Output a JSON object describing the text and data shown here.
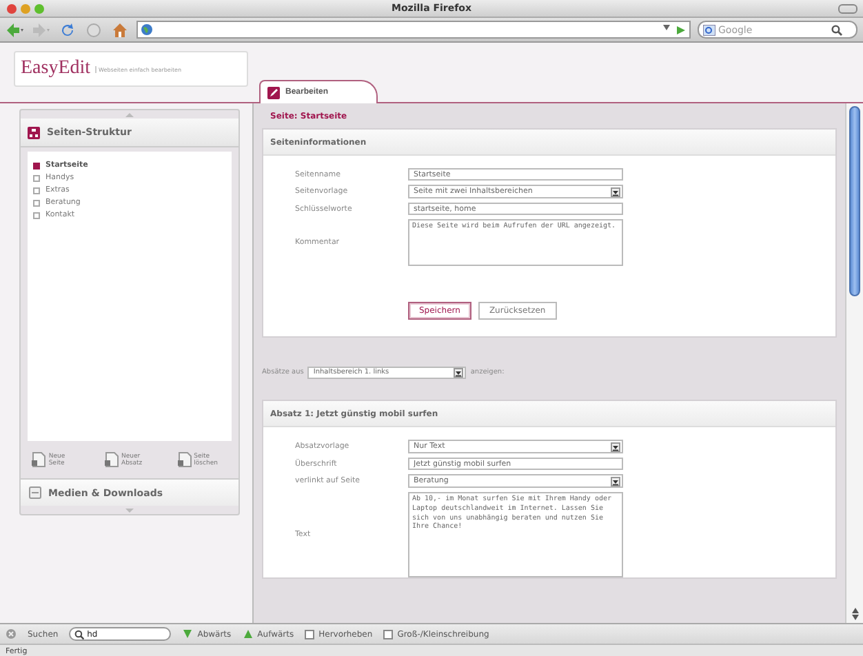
{
  "window": {
    "title": "Mozilla Firefox"
  },
  "browser": {
    "search_placeholder": "Google"
  },
  "app": {
    "logo": "EasyEdit",
    "tagline": "Webseiten einfach bearbeiten"
  },
  "sidebar": {
    "title": "Seiten-Struktur",
    "items": [
      {
        "label": "Startseite",
        "selected": true
      },
      {
        "label": "Handys",
        "selected": false
      },
      {
        "label": "Extras",
        "selected": false
      },
      {
        "label": "Beratung",
        "selected": false
      },
      {
        "label": "Kontakt",
        "selected": false
      }
    ],
    "actions": [
      {
        "label": "Neue Seite"
      },
      {
        "label": "Neuer Absatz"
      },
      {
        "label": "Seite löschen"
      }
    ],
    "media_title": "Medien & Downloads"
  },
  "tabs": [
    {
      "label": "Bearbeiten",
      "selected": true
    }
  ],
  "page_heading": "Seite: Startseite",
  "page_info": {
    "title": "Seiteninformationen",
    "fields": [
      {
        "kind": "text",
        "label": "Seitenname",
        "value": "Startseite"
      },
      {
        "kind": "select",
        "label": "Seitenvorlage",
        "value": "Seite mit zwei Inhaltsbereichen"
      },
      {
        "kind": "text",
        "label": "Schlüsselworte",
        "value": "startseite, home"
      },
      {
        "kind": "textarea",
        "label": "Kommentar",
        "value": "Diese Seite wird beim Aufrufen der URL angezeigt."
      }
    ],
    "buttons": [
      {
        "label": "Speichern",
        "primary": true
      },
      {
        "label": "Zurücksetzen",
        "primary": false
      }
    ]
  },
  "filter": {
    "prefix": "Absätze aus",
    "value": "Inhaltsbereich 1. links",
    "suffix": "anzeigen:"
  },
  "paragraph": {
    "title": "Absatz 1: Jetzt günstig mobil surfen",
    "fields": [
      {
        "kind": "select",
        "label": "Absatzvorlage",
        "value": "Nur Text"
      },
      {
        "kind": "text",
        "label": "Überschrift",
        "value": "Jetzt günstig mobil surfen"
      },
      {
        "kind": "select",
        "label": "verlinkt auf Seite",
        "value": "Beratung"
      },
      {
        "kind": "textarea",
        "label": "Text",
        "value": "Ab 10,- im Monat surfen Sie mit Ihrem Handy oder Laptop deutschlandweit im Internet. Lassen Sie sich von uns unabhängig beraten und nutzen Sie Ihre Chance!"
      }
    ]
  },
  "find_bar": {
    "label": "Suchen",
    "value": "hd",
    "buttons": [
      {
        "label": "Abwärts",
        "kind": "down"
      },
      {
        "label": "Aufwärts",
        "kind": "up"
      }
    ],
    "options": [
      {
        "label": "Hervorheben",
        "checked": false
      },
      {
        "label": "Groß-/Kleinschreibung",
        "checked": false
      }
    ]
  },
  "status_bar": "Fertig"
}
